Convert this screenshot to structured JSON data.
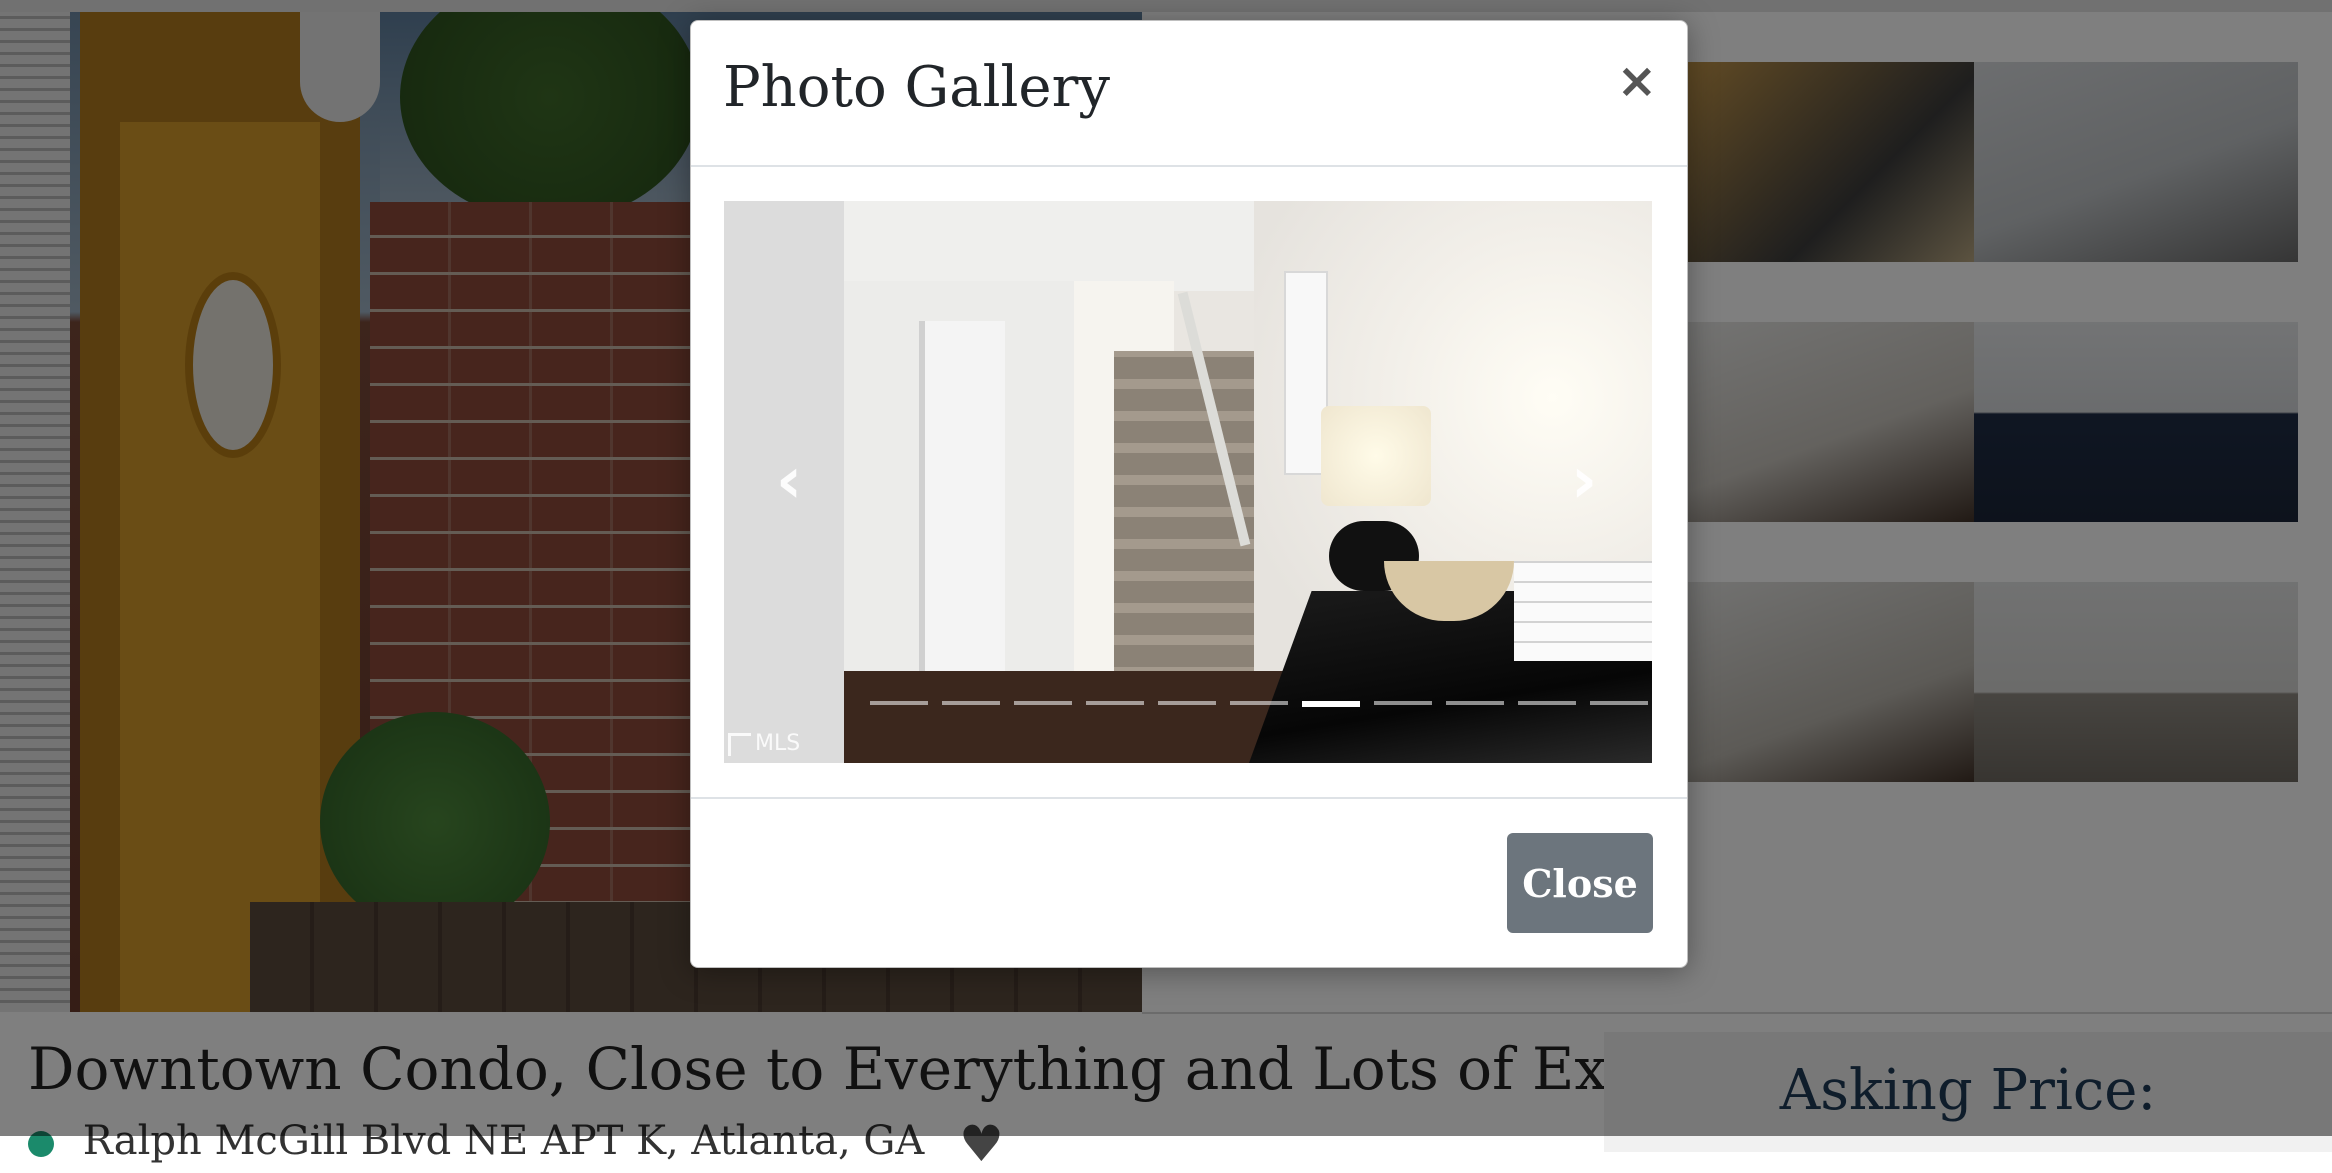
{
  "listing": {
    "title": "Downtown Condo, Close to Everything and Lots of Extras!",
    "address": "Ralph McGill Blvd NE APT K, Atlanta, GA",
    "price_heading": "Asking Price:"
  },
  "modal": {
    "title": "Photo Gallery",
    "close_symbol": "×",
    "close_button_label": "Close"
  },
  "carousel": {
    "prev_symbol": "‹",
    "next_symbol": "›",
    "watermark": "MLS",
    "slide_count": 11,
    "active_index": 6
  },
  "icons": {
    "location": "map-pin-icon",
    "favorite": "heart-icon",
    "close": "close-icon",
    "prev": "chevron-left-icon",
    "next": "chevron-right-icon"
  },
  "colors": {
    "overlay": "#00000080",
    "close_button": "#6c757d",
    "price_heading": "#1f3b57",
    "location_pin": "#1b8a6b"
  }
}
